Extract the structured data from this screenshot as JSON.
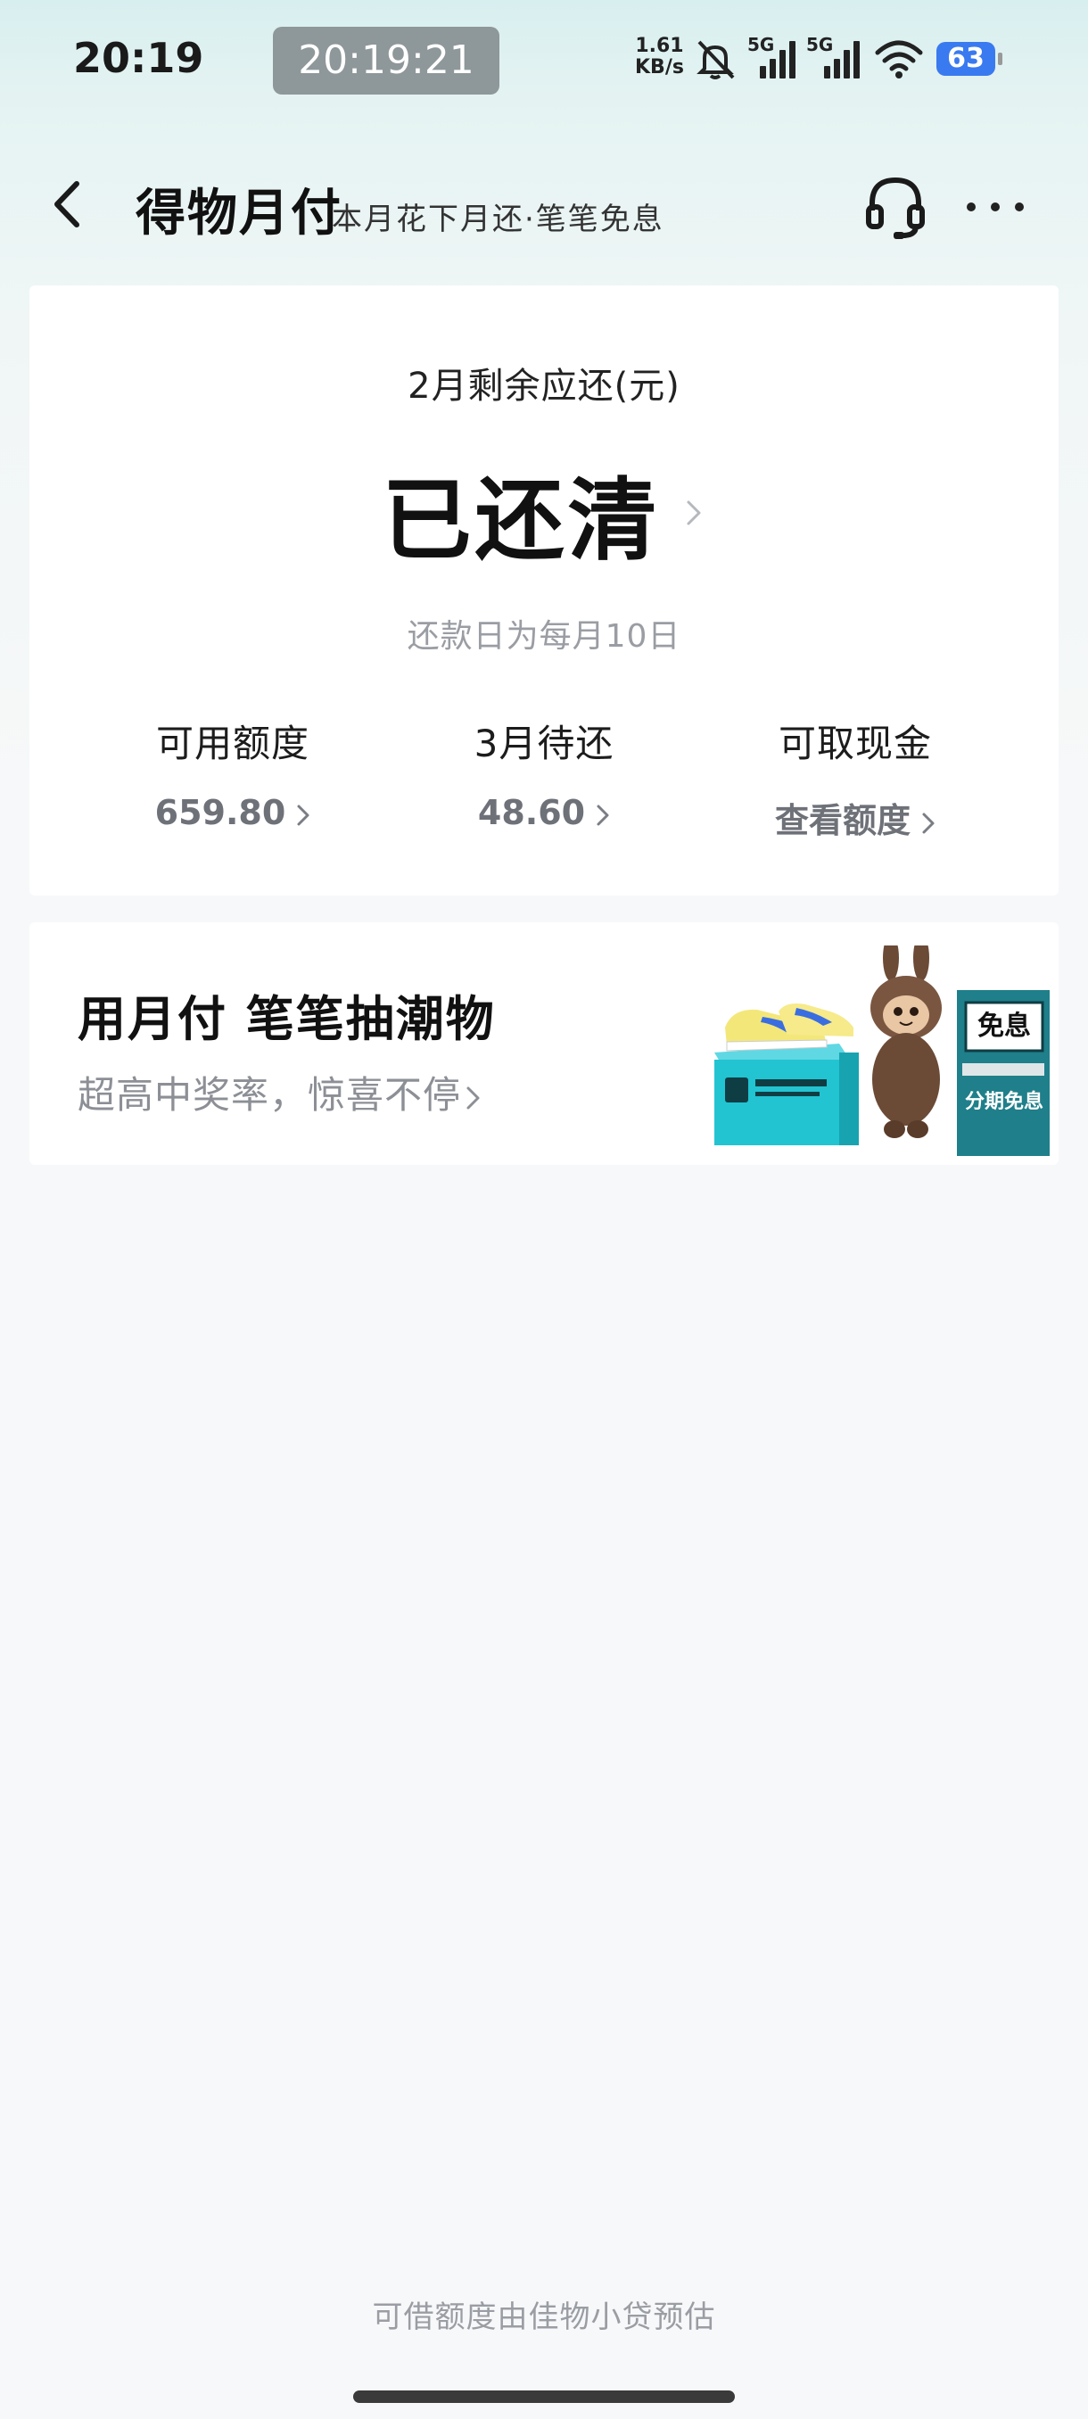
{
  "status_bar": {
    "time": "20:19",
    "screen_recorder_time": "20:19:21",
    "net_speed_value": "1.61",
    "net_speed_unit": "KB/s",
    "sim1_label": "5G",
    "sim2_label": "5G",
    "battery": "63"
  },
  "nav": {
    "title": "得物月付",
    "subtitle": "本月花下月还·笔笔免息"
  },
  "summary": {
    "label": "2月剩余应还(元)",
    "status": "已还清",
    "due_note": "还款日为每月10日",
    "stats": [
      {
        "label": "可用额度",
        "value": "659.80"
      },
      {
        "label": "3月待还",
        "value": "48.60"
      },
      {
        "label": "可取现金",
        "value": "查看额度"
      }
    ]
  },
  "promo": {
    "title": "用月付 笔笔抽潮物",
    "subtitle": "超高中奖率，惊喜不停",
    "badge_top": "免息",
    "badge_bottom": "分期免息"
  },
  "footer": {
    "note": "可借额度由佳物小贷预估"
  },
  "colors": {
    "accent_teal": "#19c2d0",
    "muted_text": "#9a9da3",
    "header_tint": "#d8efef"
  }
}
